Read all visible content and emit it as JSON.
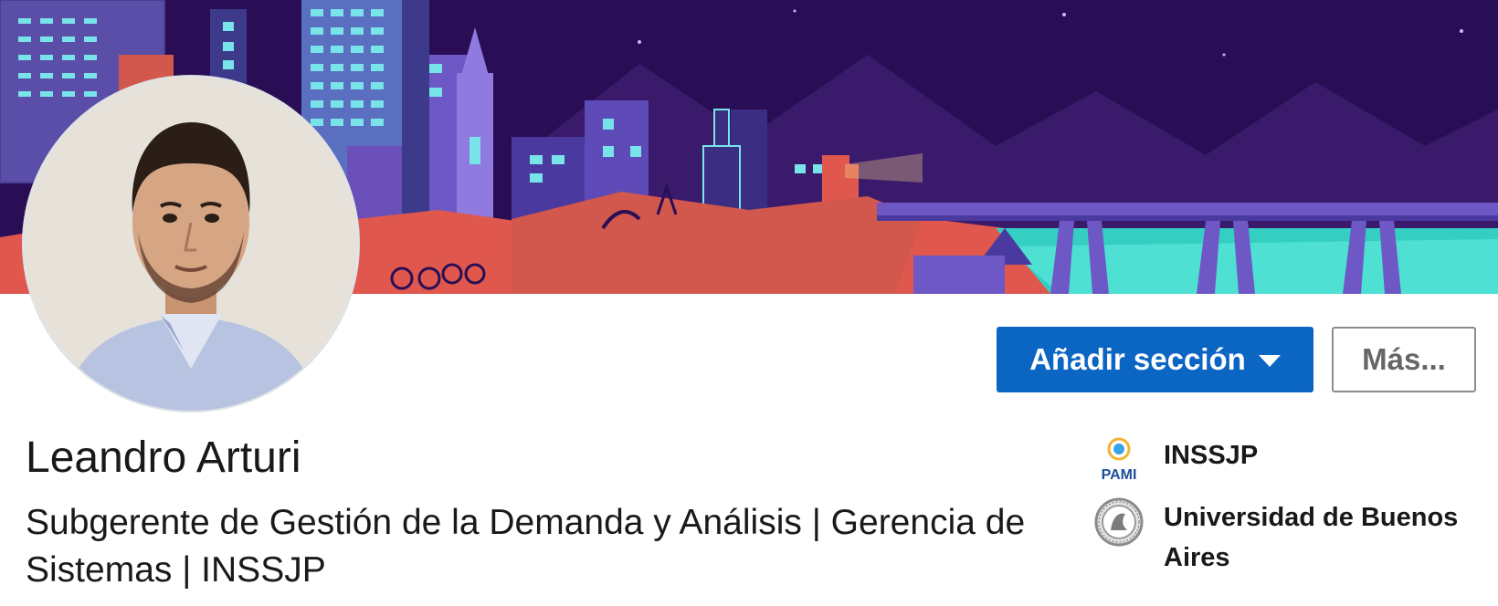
{
  "profile": {
    "name": "Leandro Arturi",
    "headline": "Subgerente de Gestión de la Demanda y Análisis | Gerencia de Sistemas | INSSJP"
  },
  "actions": {
    "add_section_label": "Añadir sección",
    "more_label": "Más..."
  },
  "organizations": [
    {
      "name": "INSSJP",
      "logo_text": "PAMI",
      "logo_icon": "pami-logo-icon"
    },
    {
      "name": "Universidad de Buenos Aires",
      "logo_icon": "uba-seal-icon"
    }
  ],
  "colors": {
    "primary_button": "#0a66c2",
    "banner_sky": "#2a0e55",
    "banner_ground": "#e0584d",
    "banner_water": "#34cfc2"
  },
  "icons": {
    "dropdown": "caret-down-icon"
  }
}
